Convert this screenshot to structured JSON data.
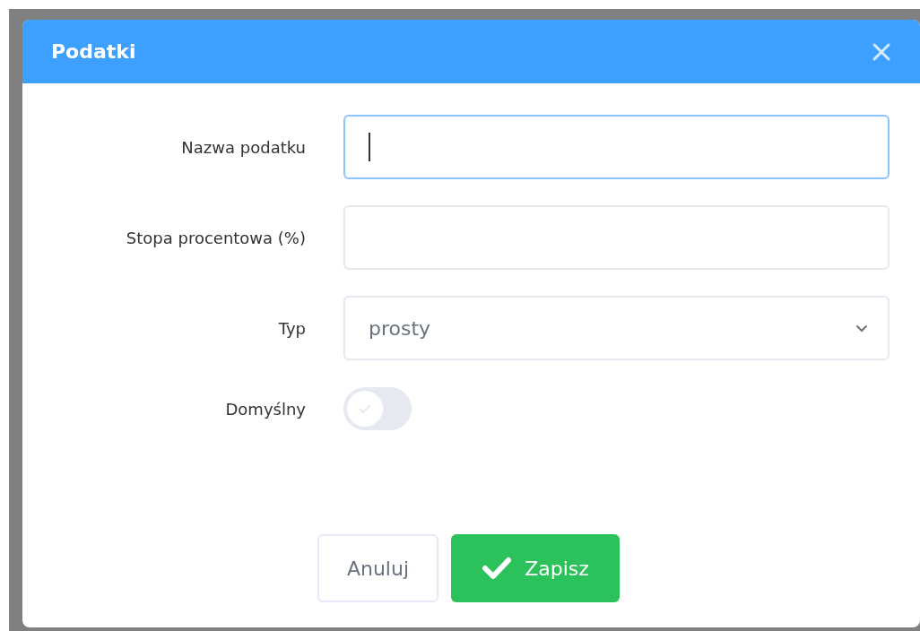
{
  "dialog": {
    "title": "Podatki"
  },
  "fields": [
    {
      "kind": "text",
      "label": "Nazwa podatku",
      "focused": true
    },
    {
      "kind": "text",
      "label": "Stopa procentowa (%)",
      "focused": false
    },
    {
      "kind": "select",
      "label": "Typ",
      "value": "prosty"
    },
    {
      "kind": "toggle",
      "label": "Domyślny",
      "on": false
    }
  ],
  "buttons": [
    {
      "kind": "secondary",
      "label": "Anuluj"
    },
    {
      "kind": "primary",
      "label": "Zapisz"
    }
  ]
}
